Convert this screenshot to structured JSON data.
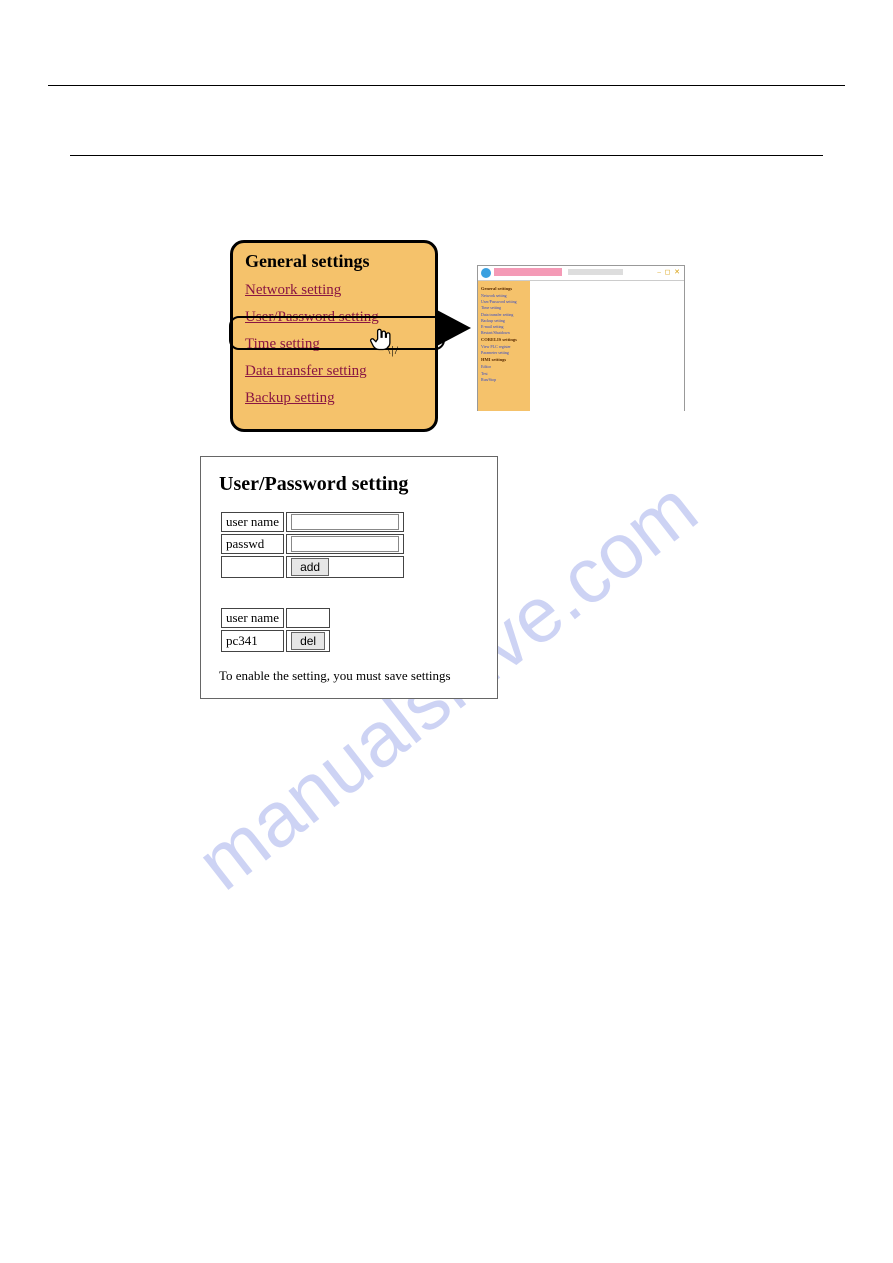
{
  "watermark": "manualshive.com",
  "callout": {
    "title": "General settings",
    "links": [
      "Network setting",
      "User/Password setting",
      "Time setting",
      "Data transfer setting",
      "Backup setting"
    ],
    "highlighted_index": 1
  },
  "browser_preview": {
    "sidebar": {
      "groups": [
        {
          "heading": "General settings",
          "items": [
            "Network setting",
            "User/Password setting",
            "Time setting",
            "Data transfer setting",
            "Backup setting",
            "E-mail setting",
            "Restart/Shutdown"
          ]
        },
        {
          "heading": "CORELIS settings",
          "items": [
            "View PLC register",
            "Parameter setting"
          ]
        },
        {
          "heading": "HMI settings",
          "items": [
            "Editor",
            "Test",
            "Run/Stop"
          ]
        }
      ]
    }
  },
  "panel": {
    "title": "User/Password setting",
    "add_form": {
      "row1_label": "user name",
      "row2_label": "passwd",
      "username_value": "",
      "password_value": "",
      "add_button": "add"
    },
    "user_list": {
      "header": "user name",
      "rows": [
        {
          "name": "pc341",
          "del_button": "del"
        }
      ]
    },
    "note": "To enable the setting, you must save settings"
  }
}
